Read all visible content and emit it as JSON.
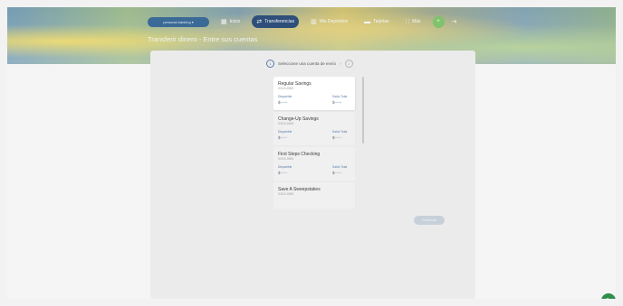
{
  "header": {
    "account_select": "personal banking ▾",
    "page_title": "Transferir dinero - Entre sus cuentas",
    "nav": [
      {
        "label": "Inicio",
        "icon": "grid-icon",
        "glyph": "▦"
      },
      {
        "label": "Transferencias",
        "icon": "transfer-icon",
        "glyph": "⇄"
      },
      {
        "label": "Mis Depósitos",
        "icon": "deposit-icon",
        "glyph": "▥"
      },
      {
        "label": "Tarjetas",
        "icon": "card-icon",
        "glyph": "▬"
      },
      {
        "label": "Más",
        "icon": "more-icon",
        "glyph": "∷"
      }
    ],
    "avatar_glyph": "+",
    "logout_glyph": "⇥"
  },
  "stepper": {
    "step_number": "1",
    "text": "Seleccione una cuenta de envío",
    "chevron": "›",
    "next_number": "2"
  },
  "accounts": [
    {
      "name": "Regular Savings",
      "number": "XXXX-0000",
      "col1_label": "Disponible",
      "col1_value": "$",
      "col1_mask": "••••••",
      "col2_label": "Saldo Total",
      "col2_value": "$",
      "col2_mask": "••••••"
    },
    {
      "name": "Change-Up Savings",
      "number": "XXXX-0000",
      "col1_label": "Disponible",
      "col1_value": "$",
      "col1_mask": "••••••",
      "col2_label": "Saldo Total",
      "col2_value": "$",
      "col2_mask": "••••••"
    },
    {
      "name": "First Steps Checking",
      "number": "XXXX-0000",
      "col1_label": "Disponible",
      "col1_value": "$",
      "col1_mask": "••••••",
      "col2_label": "Saldo Total",
      "col2_value": "$",
      "col2_mask": "••••••"
    },
    {
      "name": "Save A Sweepstakes",
      "number": "XXXX-0000"
    }
  ],
  "continue_label": "Continuar",
  "chat_glyph": "✎",
  "colors": {
    "accent": "#2f4f7a",
    "link": "#5b7ca8",
    "chat": "#2e8e4a"
  }
}
